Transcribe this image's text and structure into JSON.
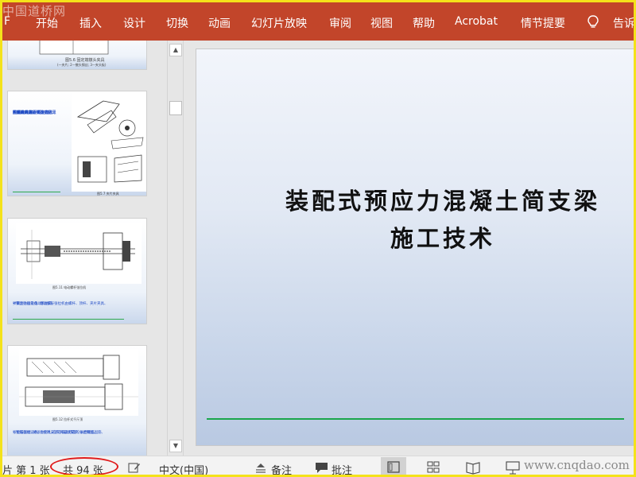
{
  "watermark_top": "中国道桥网",
  "ribbon": {
    "tabs": [
      "F",
      "开始",
      "插入",
      "设计",
      "切换",
      "动画",
      "幻灯片放映",
      "审阅",
      "视图",
      "帮助",
      "Acrobat",
      "情节提要"
    ],
    "tell_me": "告诉",
    "tell_me_icon": "lightbulb-icon"
  },
  "thumbnails": {
    "t1": {
      "caption": "图5.6 固定端镦头夹具",
      "subcaption": "(一夹片; 2—镦头钢丝; 3—夹头板)"
    },
    "t2": {
      "bullets": [
        "• 夹片夹具",
        "• 夹片夹具是夹持在锚具",
        "  内部的,与夹片配合锚",
        "  固钢绞线进行预应力张",
        "  拉的夹具。",
        "• 常用的夹片夹具有月牙",
        "  形夹具、张心夹夹具、",
        "  圆形夹具等。"
      ],
      "caption": "图5.7 夹片夹具"
    },
    "t3": {
      "caption": "图5.11 电动螺杆张拉机",
      "bullets": [
        "• 钢丝张拉设备: 电动螺杆张拉机由螺杆、顶杆、夹片夹具、",
        "  弹簧测力器及电动机组成。"
      ]
    },
    "t4": {
      "caption": "图5.12 拉杆式千斤顶",
      "bullets": [
        "• 钢筋张拉设备, 张拉时, 应先将锚具安装, 从后端锚固筋,",
        "  张拉锚固端, 将张力夹具安装在锚具后面的张拉钢丝。"
      ]
    }
  },
  "slide": {
    "title_line1": "装配式预应力混凝土简支梁",
    "title_line2": "施工技术"
  },
  "status": {
    "slide_indicator": "片 第 1 张",
    "slide_total": "共 94 张",
    "notes_icon": "notes-edit-icon",
    "language": "中文(中国)",
    "notes_label": "备注",
    "comments_label": "批注"
  },
  "watermark_bottom": "www.cnqdao.com",
  "colors": {
    "ribbon": "#c2452a",
    "frame": "#f4e21a",
    "accent_line": "#1aa64c",
    "bullet_text": "#1d49c4",
    "highlight_oval": "#e01b1b"
  }
}
